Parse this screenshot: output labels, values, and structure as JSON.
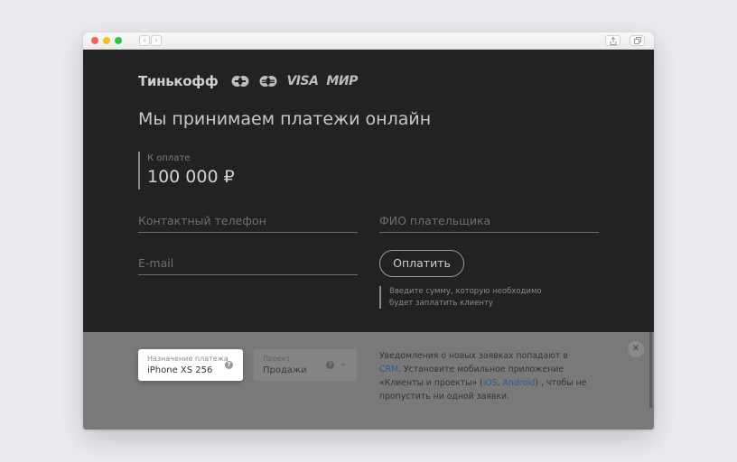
{
  "browser": {
    "back_label": "‹",
    "forward_label": "›"
  },
  "brand": {
    "name": "Тинькофф",
    "cards": [
      "mastercard-icon",
      "maestro-icon",
      "visa",
      "mir"
    ],
    "visa_label": "VISA",
    "mir_label": "МИР"
  },
  "headline": "Мы принимаем платежи онлайн",
  "amount": {
    "label": "К оплате",
    "value": "100 000 ₽"
  },
  "form": {
    "phone_placeholder": "Контактный телефон",
    "fio_placeholder": "ФИО плательщика",
    "email_placeholder": "E-mail",
    "pay_button": "Оплатить",
    "hint_line1": "Введите сумму, которую необходимо",
    "hint_line2": "будет заплатить клиенту"
  },
  "settings": {
    "purpose_label": "Назначение платежа",
    "purpose_value": "iPhone XS 256",
    "project_label": "Проект",
    "project_value": "Продажи",
    "help_glyph": "?",
    "chevron_glyph": "⌄",
    "close_glyph": "✕"
  },
  "notice": {
    "part1": "Уведомления о новых заявках попадают в ",
    "crm": "CRM",
    "part2": ". Установите мобильное приложение «Клиенты и проекты» (",
    "ios": "iOS",
    "comma": ", ",
    "android": "Android",
    "part3": ") , чтобы не пропустить ни одной заявки."
  },
  "colors": {
    "page_bg": "#222222",
    "overlay_bg": "#797979",
    "link": "#2a5a98"
  }
}
